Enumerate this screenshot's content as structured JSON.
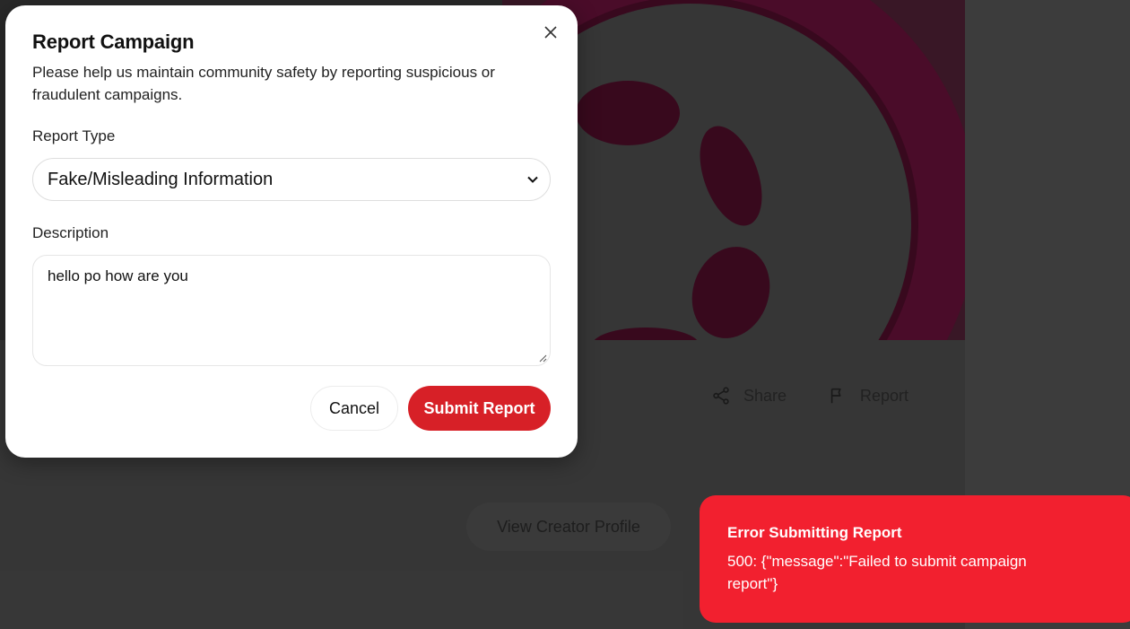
{
  "modal": {
    "title": "Report Campaign",
    "description": "Please help us maintain community safety by reporting suspicious or fraudulent campaigns.",
    "report_type_label": "Report Type",
    "report_type_value": "Fake/Misleading Information",
    "description_label": "Description",
    "description_value": "hello po how are you",
    "cancel_label": "Cancel",
    "submit_label": "Submit Report"
  },
  "background": {
    "share_label": "Share",
    "report_label": "Report",
    "creator_profile_label": "View Creator Profile"
  },
  "toast": {
    "title": "Error Submitting Report",
    "message": "500: {\"message\":\"Failed to submit campaign report\"}"
  },
  "colors": {
    "accent": "#d72027",
    "toast_bg": "#f2202f",
    "hero_maroon": "#5c0a2c"
  },
  "icons": [
    "close-icon",
    "chevron-down-icon",
    "share-icon",
    "flag-icon",
    "resize-grip-icon"
  ]
}
